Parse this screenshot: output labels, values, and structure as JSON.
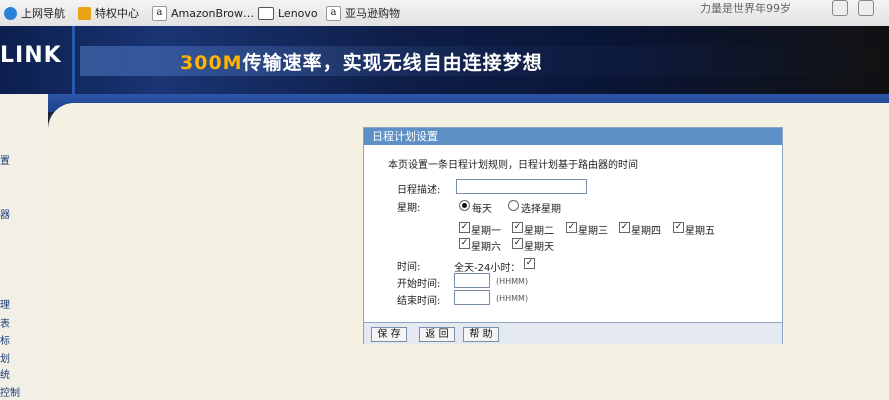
{
  "bookmarks": [
    {
      "label": "上网导航",
      "icon": "globe-icon"
    },
    {
      "label": "特权中心",
      "icon": "star-icon"
    },
    {
      "label": "AmazonBrow…",
      "icon": "amazon-icon"
    },
    {
      "label": "Lenovo",
      "icon": "folder-icon"
    },
    {
      "label": "亚马逊购物",
      "icon": "amazon-icon"
    }
  ],
  "bookmarks_right": "力量是世界年99岁",
  "banner": {
    "brand": "LINK",
    "slogan_speed": "300M",
    "slogan_text": "传输速率，实现无线自由连接梦想"
  },
  "leftnav": [
    "置",
    "器",
    "理",
    "表",
    "标",
    "划",
    "统",
    "控制"
  ],
  "form": {
    "title": "日程计划设置",
    "description": "本页设置一条日程计划规则，日程计划基于路由器的时间",
    "desc_label": "日程描述:",
    "desc_value": "",
    "week_label": "星期:",
    "every_day": "每天",
    "select_days": "选择星期",
    "days": [
      "星期一",
      "星期二",
      "星期三",
      "星期四",
      "星期五",
      "星期六",
      "星期天"
    ],
    "time_label": "时间:",
    "allday_label": "全天-24小时：",
    "start_label": "开始时间:",
    "end_label": "结束时间:",
    "hhmm": "(HHMM)",
    "buttons": {
      "save": "保 存",
      "back": "返 回",
      "help": "帮 助"
    }
  },
  "colors": {
    "header": "#5e8fc7",
    "panel_bg": "#f4f1e3",
    "banner": "#0c1f4d"
  }
}
